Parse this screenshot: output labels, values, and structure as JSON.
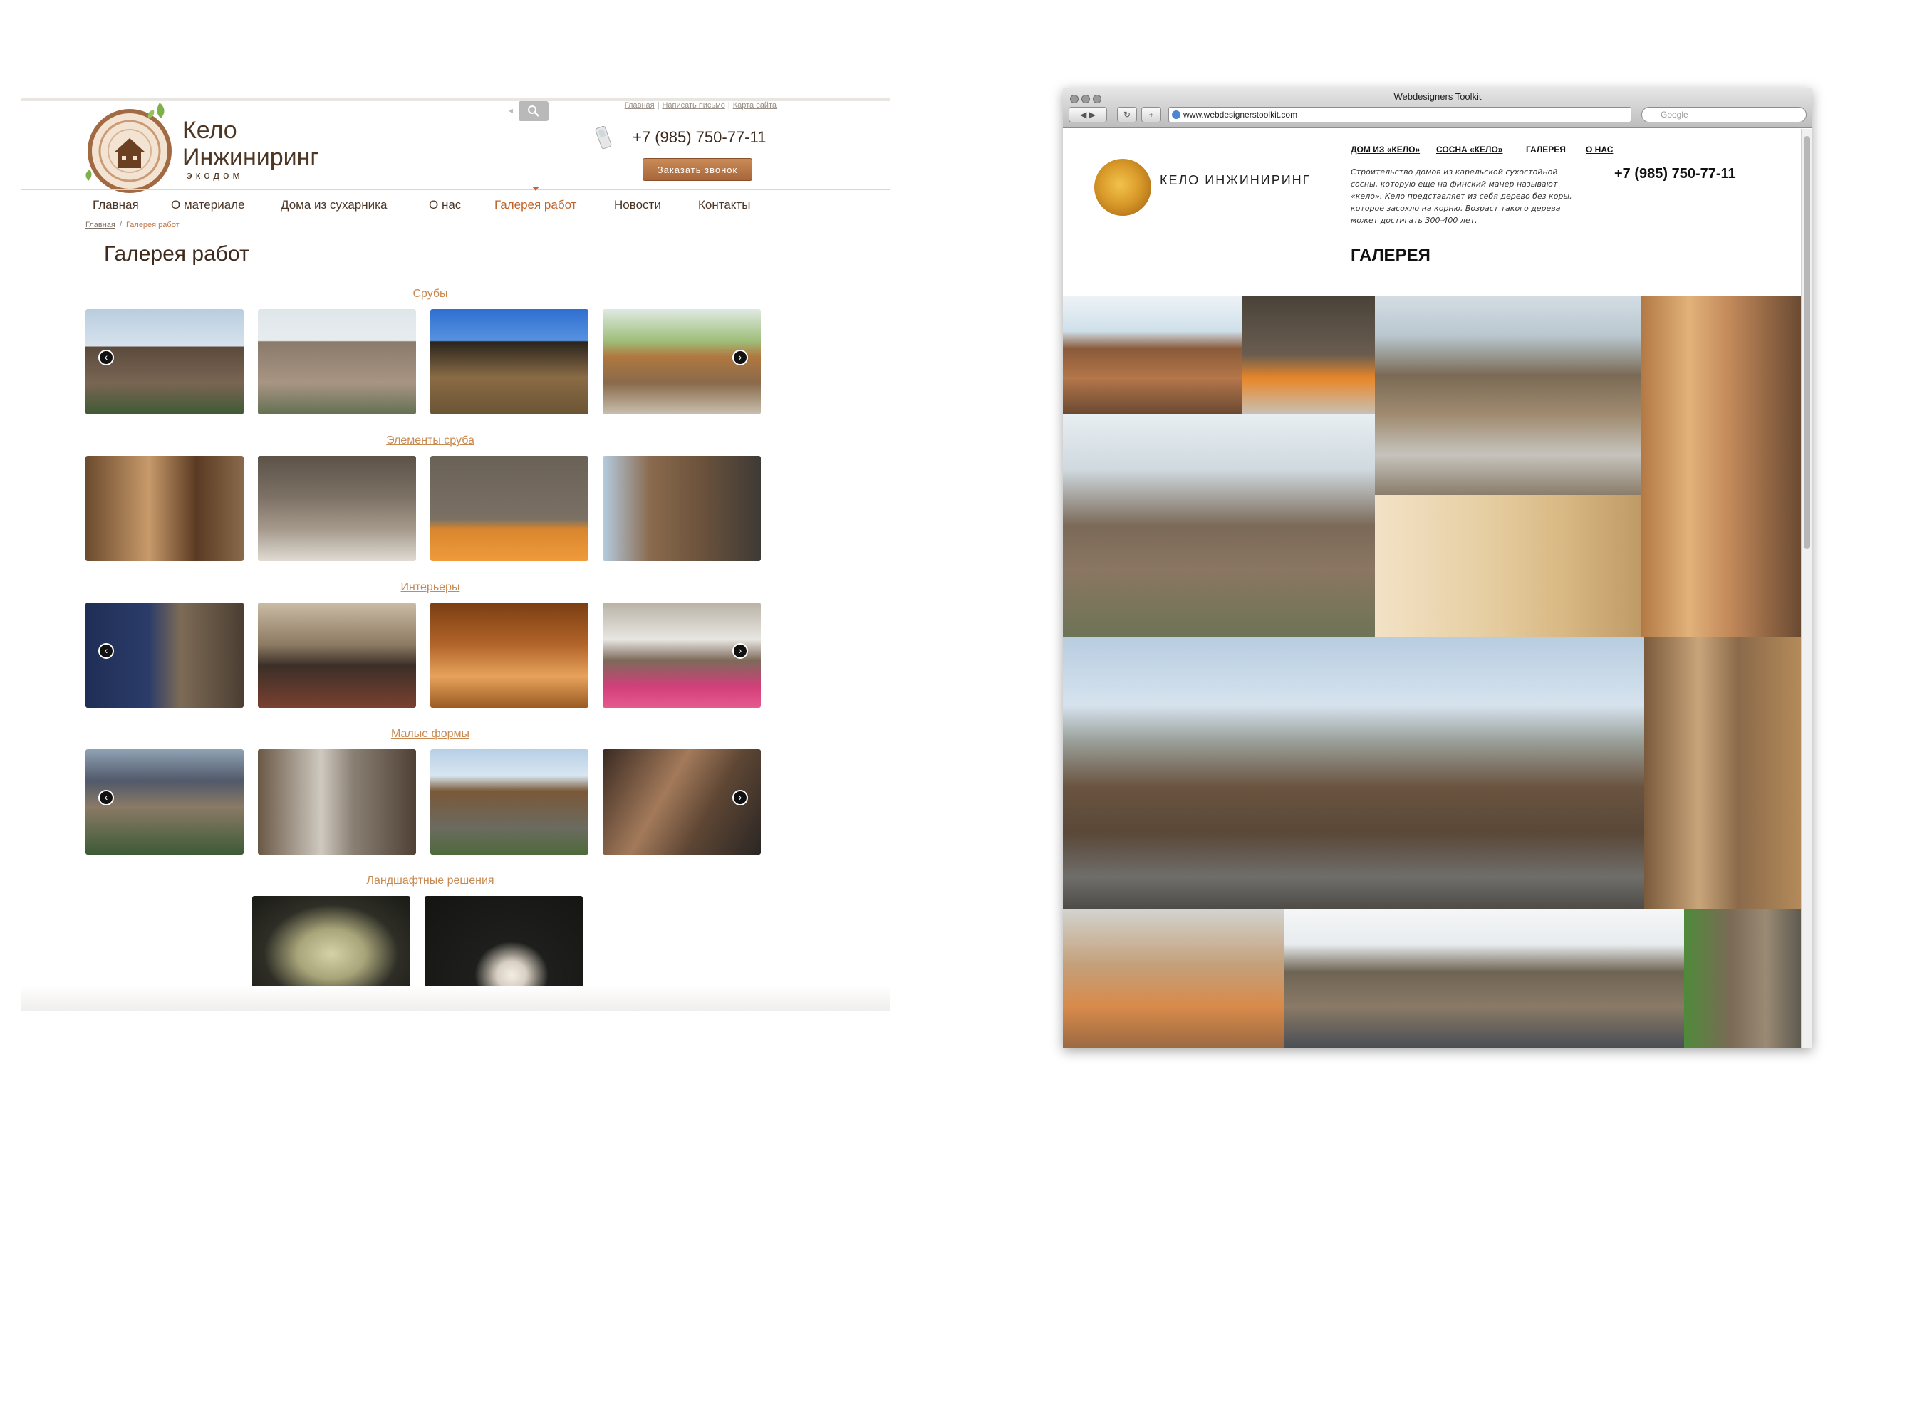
{
  "left": {
    "utility_links": [
      "Главная",
      "Написать письмо",
      "Карта сайта"
    ],
    "brand": {
      "line1": "Кело",
      "line2": "Инжиниринг",
      "line3": "экодом"
    },
    "phone": "+7 (985) 750-77-11",
    "callback_label": "Заказать звонок",
    "nav": [
      "Главная",
      "О материале",
      "Дома из сухарника",
      "О нас",
      "Галерея работ",
      "Новости",
      "Контакты"
    ],
    "nav_active": "Галерея работ",
    "breadcrumb": {
      "home": "Главная",
      "current": "Галерея работ"
    },
    "page_title": "Галерея работ",
    "categories": [
      {
        "title": "Срубы",
        "count": 4,
        "arrows": true
      },
      {
        "title": "Элементы сруба",
        "count": 4,
        "arrows": false
      },
      {
        "title": "Интерьеры",
        "count": 4,
        "arrows": true
      },
      {
        "title": "Малые формы",
        "count": 4,
        "arrows": true
      },
      {
        "title": "Ландшафтные решения",
        "count": 2,
        "arrows": false
      }
    ],
    "arrow_glyphs": {
      "left": "‹",
      "right": "›"
    }
  },
  "browser": {
    "window_title": "Webdesigners Toolkit",
    "url": "www.webdesignerstoolkit.com",
    "search_placeholder": "Google",
    "toolbar": {
      "back_forward": "◀ ▶",
      "reload": "↻",
      "add": "+"
    },
    "site": {
      "brand": "КЕЛО ИНЖИНИРИНГ",
      "nav": [
        "ДОМ ИЗ «КЕЛО»",
        "СОСНА «КЕЛО»",
        "ГАЛЕРЕЯ",
        "О НАС"
      ],
      "description": "Строительство домов из карельской сухостойной сосны, которую еще на финский манер называют «кело». Кело представляет из себя дерево без коры, которое засохло на корню. Возраст такого дерева может достигать 300-400 лет.",
      "phone": "+7 (985) 750-77-11",
      "title": "ГАЛЕРЕЯ"
    }
  },
  "colors": {
    "accent": "#c0652b",
    "link": "#c98a52",
    "text": "#4a3526"
  }
}
